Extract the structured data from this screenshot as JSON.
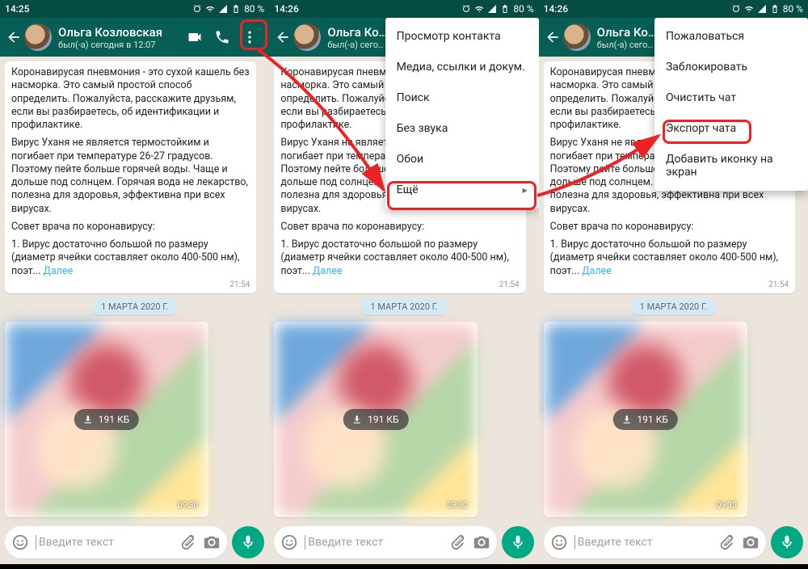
{
  "status": {
    "time1": "14:25",
    "time2": "14:26",
    "time3": "14:26",
    "battery": "80 %"
  },
  "header": {
    "name": "Ольга Козловская",
    "sub_full": "был(-а) сегодня в 12:07",
    "sub_clip": "был(-а) сегодня в 12"
  },
  "message": {
    "p1": "Коронавирусая пневмония - это сухой кашель без  насморка.  Это самый простой способ определить. Пожалуйста, расскажите друзьям, если вы разбираетесь, об идентификации и профилактике.",
    "p2a": " Вирус Уханя не является термостойким и погибает при температуре 26-27 градусов.  Поэтому пейте больше горячей воды. Чаще и дольше  под солнцем. Горячая вода не лекарство, полезна для здоровья, эффективна  при всех вирусах.",
    "p2b": " Вирус Уханя не является термостойким и погибает при температуре 26-27 градусов.  Поэтому пейте больше горячей воды. Чаще и дольше  под солнцем. Горячая вода не лекарство, полезна для здоровья, эффективна  при всех вирусах.",
    "p3": " Совет врача по коронавирусу:",
    "p4": " 1. Вирус достаточно большой по размеру (диаметр ячейки составляет около 400-500 нм), поэт... ",
    "more": "Далее",
    "time": "21:54",
    "p1_clip": "Коронавирусая пневмония - это сухой кашель без  насморка.  Это самый простой способ определить. Пожалуйста, расскажите друзьям, если вы разбираетесь, об идентификации и профилактике."
  },
  "date_chip": "1 МАРТА 2020 Г.",
  "image": {
    "size": "191 КБ",
    "time": "09:30"
  },
  "input": {
    "placeholder": "Введите текст"
  },
  "menu1": {
    "items": [
      "Просмотр контакта",
      "Медиа, ссылки и докум.",
      "Поиск",
      "Без звука",
      "Обои",
      "Ещё"
    ]
  },
  "menu2": {
    "items": [
      "Пожаловаться",
      "Заблокировать",
      "Очистить чат",
      "Экспорт чата",
      "Добавить иконку на экран"
    ]
  }
}
